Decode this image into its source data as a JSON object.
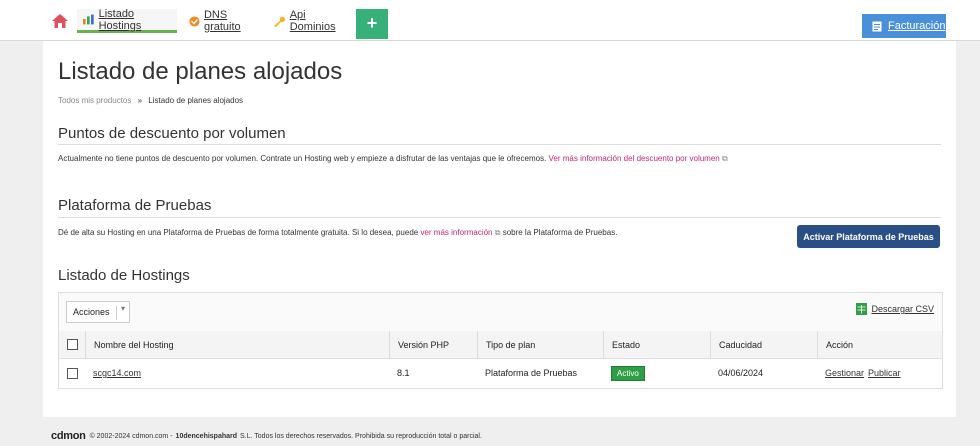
{
  "topbar": {
    "tabs": [
      {
        "label": "Listado Hostings",
        "icon": "bar-chart-icon"
      },
      {
        "label": "DNS gratuito",
        "icon": "dns-globe-icon"
      },
      {
        "label": "Api Dominios",
        "icon": "key-icon"
      }
    ],
    "plus": "+",
    "facturacion": "Facturación"
  },
  "page": {
    "title": "Listado de planes alojados",
    "breadcrumb_root": "Todos mis productos",
    "breadcrumb_sep": "»",
    "breadcrumb_current": "Listado de planes alojados"
  },
  "descuento": {
    "heading": "Puntos de descuento por volumen",
    "text": "Actualmente no tiene puntos de descuento por volumen. Contrate un Hosting web y empieze a disfrutar de las ventajas que le ofrecemos.",
    "link": "Ver más información del descuento por volumen"
  },
  "pruebas": {
    "heading": "Plataforma de Pruebas",
    "text_before": "Dé de alta su Hosting en una Plataforma de Pruebas de forma totalmente gratuita. Si lo desea, puede",
    "link": "ver más información",
    "text_after": "sobre la Plataforma de Pruebas.",
    "button": "Activar Plataforma de Pruebas"
  },
  "hostings": {
    "heading": "Listado de Hostings",
    "acciones": "Acciones",
    "csv": "Descargar CSV",
    "columns": [
      "Nombre del Hosting",
      "Versión PHP",
      "Tipo de plan",
      "Estado",
      "Caducidad",
      "Acción"
    ],
    "rows": [
      {
        "name": "scgc14.com",
        "php": "8.1",
        "plan": "Plataforma de Pruebas",
        "estado": "Activo",
        "caducidad": "04/06/2024",
        "gestionar": "Gestionar",
        "publicar": "Publicar"
      }
    ]
  },
  "footer": {
    "logo": "cdmon",
    "text_pre": "© 2002-2024 cdmon.com -",
    "company": "10dencehispahard",
    "text_post": "S.L. Todos los derechos reservados. Prohibida su reproducción total o parcial."
  },
  "colors": {
    "accent": "#2a4f86",
    "success": "#2f9e44",
    "link_pink": "#c0287a",
    "billing": "#4a90d9",
    "plus": "#38b07a"
  }
}
